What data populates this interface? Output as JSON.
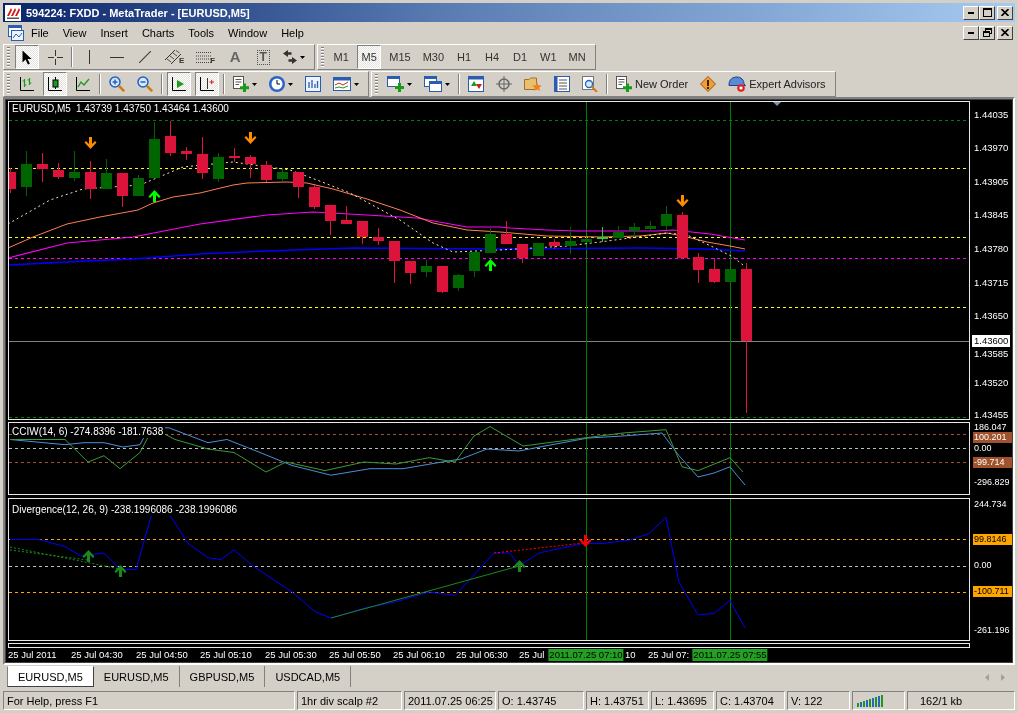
{
  "window": {
    "title": "594224: FXDD - MetaTrader - [EURUSD,M5]"
  },
  "menu": [
    "File",
    "View",
    "Insert",
    "Charts",
    "Tools",
    "Window",
    "Help"
  ],
  "toolbar_rows": [
    [
      {
        "groups": [
          [
            {
              "kind": "cursor",
              "selected": true
            },
            {
              "kind": "crosshair",
              "selected": false
            }
          ],
          [
            {
              "kind": "vline",
              "selected": false
            },
            {
              "kind": "hline",
              "selected": false
            },
            {
              "kind": "trendline",
              "selected": false
            },
            {
              "kind": "channel",
              "selected": false,
              "badge": "E"
            },
            {
              "kind": "fibonacci",
              "selected": false,
              "badge": "F"
            },
            {
              "kind": "text",
              "selected": false,
              "label": "A"
            },
            {
              "kind": "label",
              "selected": false,
              "label": "T"
            },
            {
              "kind": "arrows",
              "selected": false,
              "dropdown": true
            }
          ]
        ]
      },
      {
        "groups": [
          [
            {
              "kind": "period",
              "label": "M1",
              "selected": false
            },
            {
              "kind": "period",
              "label": "M5",
              "selected": true
            },
            {
              "kind": "period",
              "label": "M15",
              "selected": false
            },
            {
              "kind": "period",
              "label": "M30",
              "selected": false
            },
            {
              "kind": "period",
              "label": "H1",
              "selected": false
            },
            {
              "kind": "period",
              "label": "H4",
              "selected": false
            },
            {
              "kind": "period",
              "label": "D1",
              "selected": false
            },
            {
              "kind": "period",
              "label": "W1",
              "selected": false
            },
            {
              "kind": "period",
              "label": "MN",
              "selected": false
            }
          ]
        ]
      }
    ],
    [
      {
        "groups": [
          [
            {
              "kind": "bars",
              "selected": false
            },
            {
              "kind": "candles",
              "selected": true
            },
            {
              "kind": "line",
              "selected": false
            }
          ],
          [
            {
              "kind": "zoomin",
              "selected": false
            },
            {
              "kind": "zoomout",
              "selected": false
            }
          ],
          [
            {
              "kind": "autoscroll",
              "selected": true
            },
            {
              "kind": "shift",
              "selected": true
            }
          ],
          [
            {
              "kind": "indicators",
              "selected": false,
              "dropdown": true
            },
            {
              "kind": "periods",
              "selected": false,
              "dropdown": true
            },
            {
              "kind": "templates",
              "selected": false
            },
            {
              "kind": "chartwindow",
              "selected": false,
              "dropdown": true
            }
          ]
        ]
      },
      {
        "groups": [
          [
            {
              "kind": "newchart",
              "dropdown": true
            },
            {
              "kind": "profiles",
              "dropdown": true
            }
          ],
          [
            {
              "kind": "marketwatch"
            },
            {
              "kind": "navigator"
            },
            {
              "kind": "favorites"
            },
            {
              "kind": "datawindow"
            },
            {
              "kind": "tester"
            }
          ],
          [
            {
              "kind": "neworder",
              "label": "New Order"
            },
            {
              "kind": "alert"
            },
            {
              "kind": "experts",
              "label": "Expert Advisors"
            }
          ]
        ]
      }
    ]
  ],
  "chart": {
    "symbol": "EURUSD,M5",
    "quotes": "1.43739 1.43750 1.43464 1.43600",
    "price_axis": [
      "1.44035",
      "1.43970",
      "1.43905",
      "1.43845",
      "1.43780",
      "1.43715",
      "1.43650",
      "1.43585",
      "1.43520",
      "1.43455"
    ],
    "current_price": "1.43600",
    "indicators": [
      {
        "kind": "cci",
        "title": "CCIW(14, 6) -274.8396 -181.7638",
        "axis": [
          {
            "label": "186.047"
          },
          {
            "label": "100.201",
            "color": "#a0522d"
          },
          {
            "label": "0.00"
          },
          {
            "label": "-99.714",
            "color": "#a0522d"
          },
          {
            "label": "-296.829"
          }
        ]
      },
      {
        "kind": "divergence",
        "title": "Divergence(12, 26, 9) -238.1996086 -238.1996086",
        "axis": [
          {
            "label": "244.734"
          },
          {
            "label": "99.8146",
            "color": "#ffa500"
          },
          {
            "label": "0.00"
          },
          {
            "label": "-100.711",
            "color": "#ffa500"
          },
          {
            "label": "-261.196"
          }
        ]
      }
    ],
    "time_axis": {
      "labels": [
        "25 Jul 2011",
        "25 Jul 04:30",
        "25 Jul 04:50",
        "25 Jul 05:10",
        "25 Jul 05:30",
        "25 Jul 05:50",
        "25 Jul 06:10",
        "25 Jul 06:30",
        "25 Jul",
        "10",
        "25 Jul 07:"
      ],
      "markers": [
        "2011.07.25 07:10",
        "2011.07.25 07:55"
      ]
    }
  },
  "tabs": [
    {
      "label": "EURUSD,M5",
      "selected": true
    },
    {
      "label": "EURUSD,M5",
      "selected": false
    },
    {
      "label": "GBPUSD,M5",
      "selected": false
    },
    {
      "label": "USDCAD,M5",
      "selected": false
    }
  ],
  "status_bar": [
    {
      "kind": "text",
      "text": "For Help, press F1"
    },
    {
      "kind": "text",
      "text": "1hr div scalp #2"
    },
    {
      "kind": "text",
      "text": "2011.07.25 06:25"
    },
    {
      "kind": "text",
      "text": "O: 1.43745"
    },
    {
      "kind": "text",
      "text": "H: 1.43751"
    },
    {
      "kind": "text",
      "text": "L: 1.43695"
    },
    {
      "kind": "text",
      "text": "C: 1.43704"
    },
    {
      "kind": "text",
      "text": "V: 122"
    },
    {
      "kind": "connection"
    },
    {
      "kind": "text",
      "text": "162/1 kb"
    }
  ]
}
